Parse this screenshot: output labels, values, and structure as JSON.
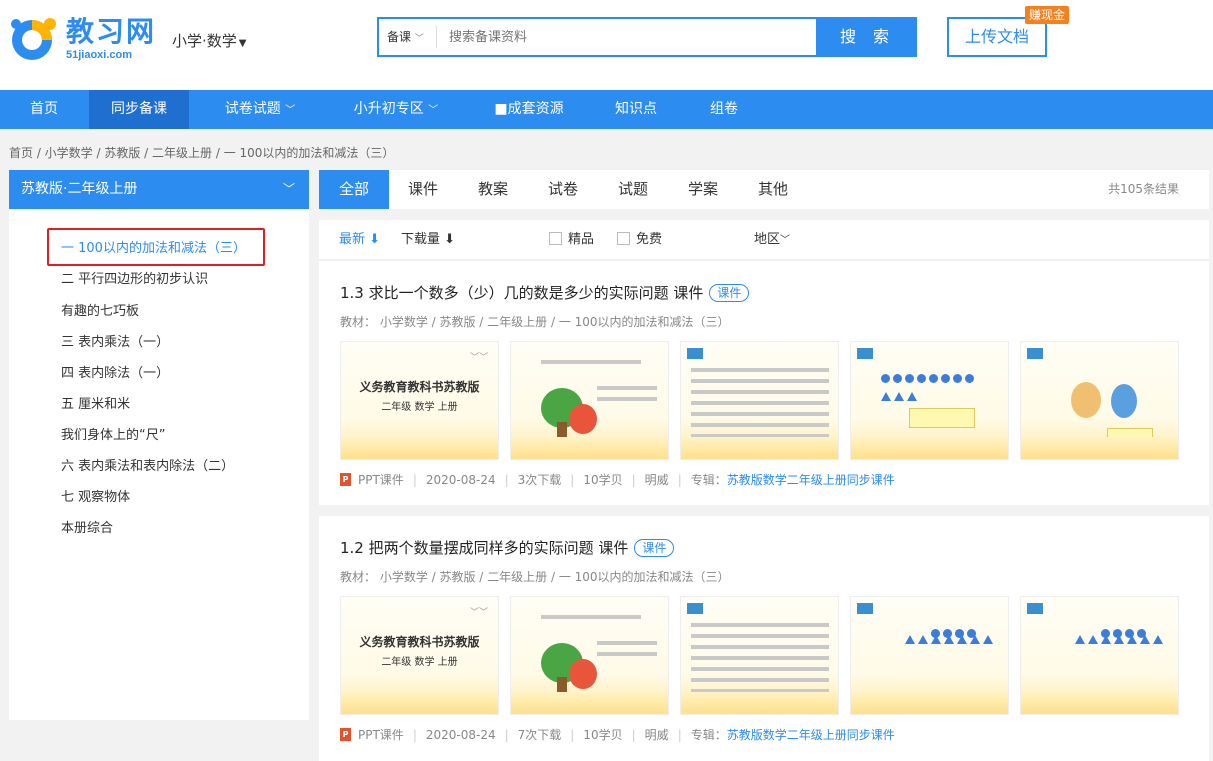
{
  "header": {
    "logo_name": "教习网",
    "logo_url": "51jiaoxi.com",
    "subject_label": "小学·数学",
    "search_type": "备课",
    "search_placeholder": "搜索备课资料",
    "search_button": "搜 索",
    "upload_button": "上传文档",
    "earn_badge": "赚现金"
  },
  "nav": {
    "items": [
      {
        "label": "首页"
      },
      {
        "label": "同步备课"
      },
      {
        "label": "试卷试题"
      },
      {
        "label": "小升初专区"
      },
      {
        "label": "■成套资源"
      },
      {
        "label": "知识点"
      },
      {
        "label": "组卷"
      }
    ]
  },
  "breadcrumb": "首页 /  小学数学 / 苏教版 / 二年级上册 / 一 100以内的加法和减法（三）",
  "sidebar": {
    "title": "苏教版·二年级上册",
    "items": [
      {
        "label": "一 100以内的加法和减法（三）"
      },
      {
        "label": "二 平行四边形的初步认识"
      },
      {
        "label": "有趣的七巧板"
      },
      {
        "label": "三 表内乘法（一）"
      },
      {
        "label": "四 表内除法（一）"
      },
      {
        "label": "五 厘米和米"
      },
      {
        "label": "我们身体上的“尺”"
      },
      {
        "label": "六 表内乘法和表内除法（二）"
      },
      {
        "label": "七 观察物体"
      },
      {
        "label": "本册综合"
      }
    ]
  },
  "tabs": {
    "items": [
      {
        "label": "全部"
      },
      {
        "label": "课件"
      },
      {
        "label": "教案"
      },
      {
        "label": "试卷"
      },
      {
        "label": "试题"
      },
      {
        "label": "学案"
      },
      {
        "label": "其他"
      }
    ],
    "result_count": "共105条结果"
  },
  "filters": {
    "latest": "最新 ⬇",
    "downloads": "下载量 ⬇",
    "premium": "精品",
    "free": "免费",
    "region": "地区"
  },
  "results": [
    {
      "title": "1.3 求比一个数多（少）几的数是多少的实际问题 课件",
      "tag": "课件",
      "path": "教材：  小学数学  /  苏教版  /  二年级上册  /  一 100以内的加法和减法（三）",
      "thumb_title": "义务教育教科书苏教版",
      "thumb_sub": "二年级   数学   上册",
      "type": "PPT课件",
      "date": "2020-08-24",
      "downloads": "3次下载",
      "coins": "10学贝",
      "author": "明威",
      "album_prefix": "专辑：",
      "album": "苏教版数学二年级上册同步课件"
    },
    {
      "title": "1.2 把两个数量摆成同样多的实际问题 课件",
      "tag": "课件",
      "path": "教材：  小学数学  /  苏教版  /  二年级上册  /  一 100以内的加法和减法（三）",
      "thumb_title": "义务教育教科书苏教版",
      "thumb_sub": "二年级   数学   上册",
      "type": "PPT课件",
      "date": "2020-08-24",
      "downloads": "7次下载",
      "coins": "10学贝",
      "author": "明威",
      "album_prefix": "专辑：",
      "album": "苏教版数学二年级上册同步课件"
    }
  ],
  "colors": {
    "accent": "#2d8cf0",
    "highlight_box": "#e02020",
    "badge": "#f5801e"
  }
}
